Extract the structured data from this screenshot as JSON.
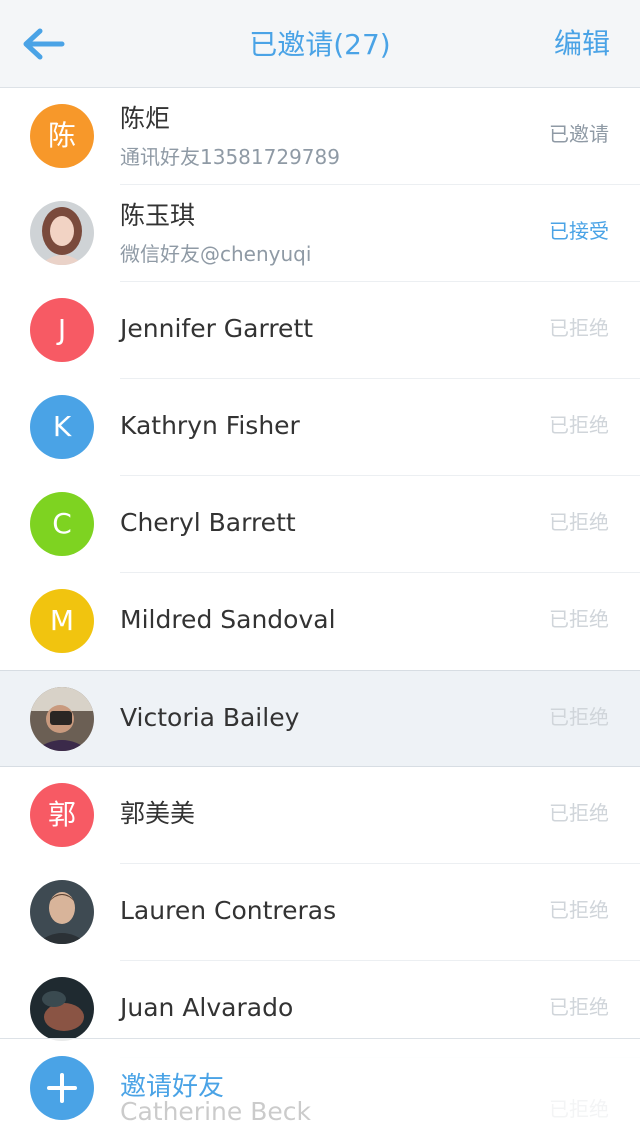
{
  "header": {
    "title": "已邀请(27)",
    "edit_label": "编辑",
    "back_icon": "arrow-left-icon"
  },
  "colors": {
    "accent": "#4aa3e6",
    "orange": "#f7982a",
    "red": "#f75a64",
    "blue": "#4aa3e6",
    "green": "#7ed321",
    "yellow": "#f1c40f"
  },
  "contacts": [
    {
      "name": "陈炬",
      "sub": "通讯好友13581729789",
      "status": "已邀请",
      "status_type": "invited",
      "avatar_letter": "陈",
      "avatar_color": "#f7982a"
    },
    {
      "name": "陈玉琪",
      "sub": "微信好友@chenyuqi",
      "status": "已接受",
      "status_type": "accepted",
      "avatar_photo": "photo-woman"
    },
    {
      "name": "Jennifer Garrett",
      "status": "已拒绝",
      "status_type": "rejected",
      "avatar_letter": "J",
      "avatar_color": "#f75a64"
    },
    {
      "name": "Kathryn Fisher",
      "status": "已拒绝",
      "status_type": "rejected",
      "avatar_letter": "K",
      "avatar_color": "#4aa3e6"
    },
    {
      "name": "Cheryl Barrett",
      "status": "已拒绝",
      "status_type": "rejected",
      "avatar_letter": "C",
      "avatar_color": "#7ed321"
    },
    {
      "name": "Mildred Sandoval",
      "status": "已拒绝",
      "status_type": "rejected",
      "avatar_letter": "M",
      "avatar_color": "#f1c40f"
    },
    {
      "name": "Victoria Bailey",
      "status": "已拒绝",
      "status_type": "rejected",
      "avatar_photo": "photo-man-camera",
      "selected": true
    },
    {
      "name": "郭美美",
      "status": "已拒绝",
      "status_type": "rejected",
      "avatar_letter": "郭",
      "avatar_color": "#f75a64"
    },
    {
      "name": "Lauren Contreras",
      "status": "已拒绝",
      "status_type": "rejected",
      "avatar_photo": "photo-man"
    },
    {
      "name": "Juan Alvarado",
      "status": "已拒绝",
      "status_type": "rejected",
      "avatar_photo": "photo-dark"
    }
  ],
  "partial_contact": {
    "name": "Catherine Beck",
    "status": "已拒绝"
  },
  "footer": {
    "invite_label": "邀请好友",
    "add_icon": "plus-icon"
  }
}
